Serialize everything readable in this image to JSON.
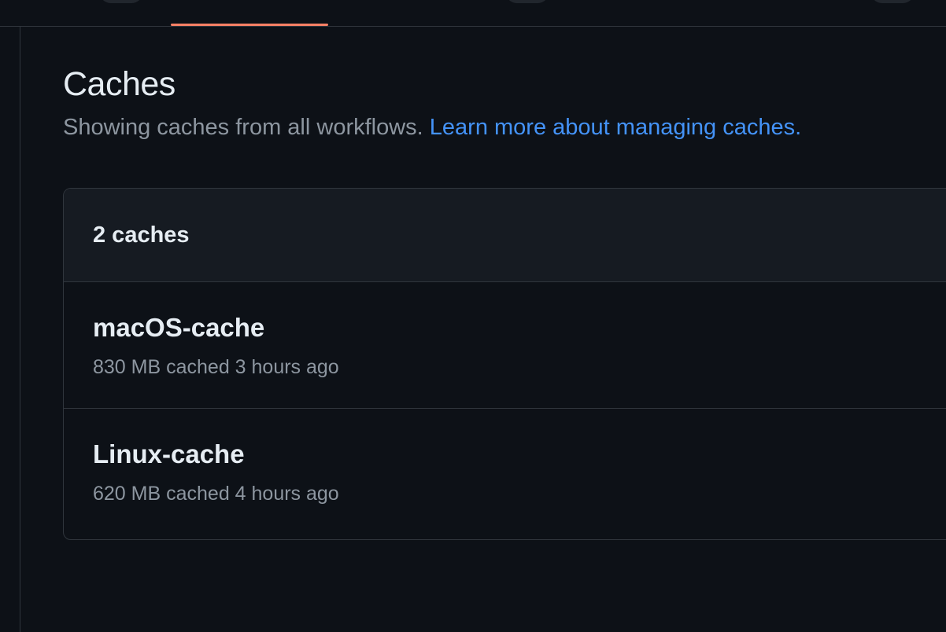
{
  "header": {
    "active_tab_indicator_color": "#f78166"
  },
  "page": {
    "title": "Caches",
    "subtitle_text": "Showing caches from all workflows. ",
    "subtitle_link": "Learn more about managing caches."
  },
  "caches_box": {
    "count_label": "2 caches",
    "items": [
      {
        "name": "macOS-cache",
        "meta": "830 MB cached 3 hours ago"
      },
      {
        "name": "Linux-cache",
        "meta": "620 MB cached 4 hours ago"
      }
    ]
  }
}
